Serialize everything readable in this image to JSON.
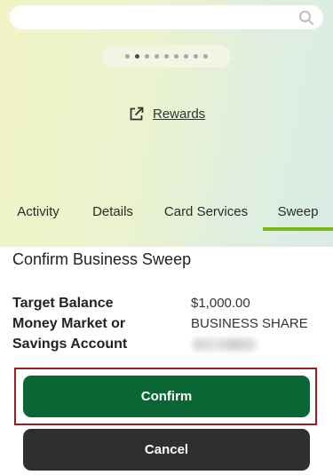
{
  "search": {
    "placeholder": "",
    "icon": "search-icon"
  },
  "carousel": {
    "count": 9,
    "active_index": 1
  },
  "rewards": {
    "label": "Rewards",
    "icon": "external-link-icon"
  },
  "tabs": [
    {
      "label": "Activity",
      "active": false
    },
    {
      "label": "Details",
      "active": false
    },
    {
      "label": "Card Services",
      "active": false
    },
    {
      "label": "Sweep",
      "active": true
    }
  ],
  "page": {
    "title": "Confirm Business Sweep"
  },
  "summary": {
    "target_balance_label": "Target Balance",
    "target_balance_value": "$1,000.00",
    "account_label": "Money Market or Savings Account",
    "account_value": "BUSINESS SHARE"
  },
  "buttons": {
    "confirm": "Confirm",
    "cancel": "Cancel"
  },
  "colors": {
    "accent": "#7cb518",
    "confirm_bg": "#0a6632",
    "cancel_bg": "#2f2f2f",
    "focus_outline": "#9b1b1b"
  }
}
